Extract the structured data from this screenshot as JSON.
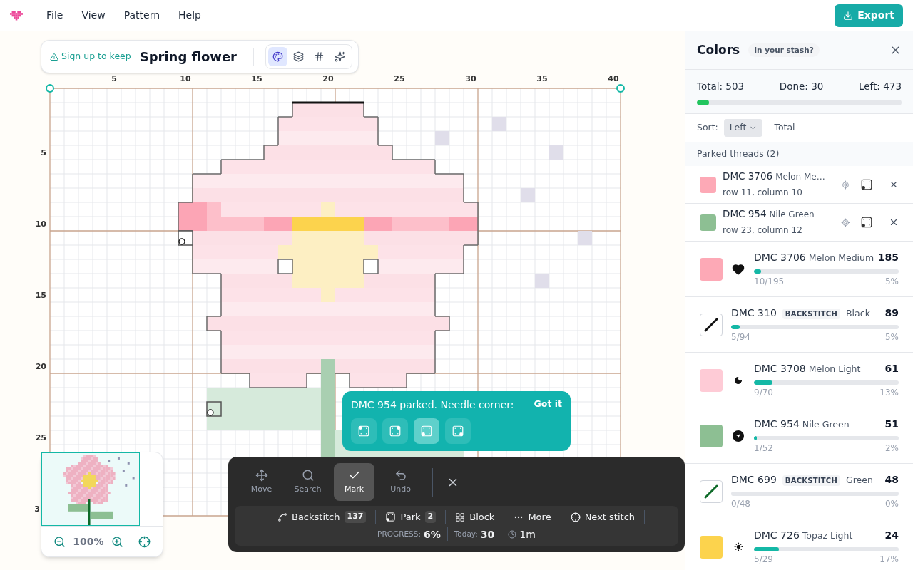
{
  "menu": [
    "File",
    "View",
    "Pattern",
    "Help"
  ],
  "export_button": "Export",
  "title_card": {
    "signup_link": "Sign up to keep",
    "pattern_name": "Spring flower",
    "tools": [
      {
        "selected": true
      },
      {
        "selected": false
      },
      {
        "selected": false
      },
      {
        "selected": false
      }
    ]
  },
  "rulers": {
    "columns": [
      "5",
      "10",
      "15",
      "20",
      "25",
      "30",
      "35",
      "40"
    ],
    "rows": [
      "5",
      "10",
      "15",
      "20",
      "25",
      "3"
    ]
  },
  "minimap": {
    "zoom": "100%"
  },
  "tip": {
    "message": "DMC 954 parked. Needle corner:",
    "dismiss": "Got it",
    "corners": [
      {
        "selected": false
      },
      {
        "selected": false
      },
      {
        "selected": true
      },
      {
        "selected": false
      }
    ]
  },
  "toolbar": {
    "tools": [
      {
        "label": "Move",
        "selected": false
      },
      {
        "label": "Search",
        "selected": false
      },
      {
        "label": "Mark",
        "selected": true
      },
      {
        "label": "Undo",
        "selected": false
      }
    ],
    "actions": [
      {
        "label": "Backstitch",
        "count": "137"
      },
      {
        "label": "Park",
        "count": "2"
      },
      {
        "label": "Block"
      },
      {
        "label": "More"
      },
      {
        "label": "Next stitch"
      }
    ],
    "progress_label": "PROGRESS:",
    "progress": "6%",
    "today_label": "Today:",
    "today": "30",
    "time": "1m"
  },
  "panel": {
    "title": "Colors",
    "badge": "In your stash?",
    "total": "Total: 503",
    "done": "Done: 30",
    "left": "Left: 473",
    "level": 0.06,
    "sort_label": "Sort:",
    "sort_options": [
      {
        "label": "Left",
        "selected": true
      },
      {
        "label": "Total",
        "selected": false
      }
    ],
    "parked_title": "Parked threads (2)",
    "parked": [
      {
        "code": "DMC 3706",
        "name": "Melon Me…",
        "position": "row 11, column 10",
        "color": "#fda9b6"
      },
      {
        "code": "DMC 954",
        "name": "Nile Green",
        "position": "row 23, column 12",
        "color": "#8dbf93"
      }
    ],
    "threads": [
      {
        "kind": "cross",
        "code": "DMC 3706",
        "name": "Melon Medium",
        "remaining": "185",
        "progress": "10/195",
        "percent": "5%",
        "level": 0.05,
        "color": "#fda9b6"
      },
      {
        "kind": "backstitch",
        "code": "DMC 310",
        "tag": "BACKSTITCH",
        "name": "Black",
        "remaining": "89",
        "progress": "5/94",
        "percent": "5%",
        "level": 0.05,
        "color": "#111111"
      },
      {
        "kind": "cross",
        "code": "DMC 3708",
        "name": "Melon Light",
        "remaining": "61",
        "progress": "9/70",
        "percent": "13%",
        "level": 0.13,
        "color": "#fecbd6"
      },
      {
        "kind": "cross",
        "code": "DMC 954",
        "name": "Nile Green",
        "remaining": "51",
        "progress": "1/52",
        "percent": "2%",
        "level": 0.02,
        "color": "#8dbf93"
      },
      {
        "kind": "backstitch",
        "code": "DMC 699",
        "tag": "BACKSTITCH",
        "name": "Green",
        "remaining": "48",
        "progress": "0/48",
        "percent": "0%",
        "level": 0,
        "color": "#0f6b2a"
      },
      {
        "kind": "cross",
        "code": "DMC 726",
        "name": "Topaz Light",
        "remaining": "24",
        "progress": "5/29",
        "percent": "17%",
        "level": 0.17,
        "color": "#fcd34d"
      }
    ]
  }
}
